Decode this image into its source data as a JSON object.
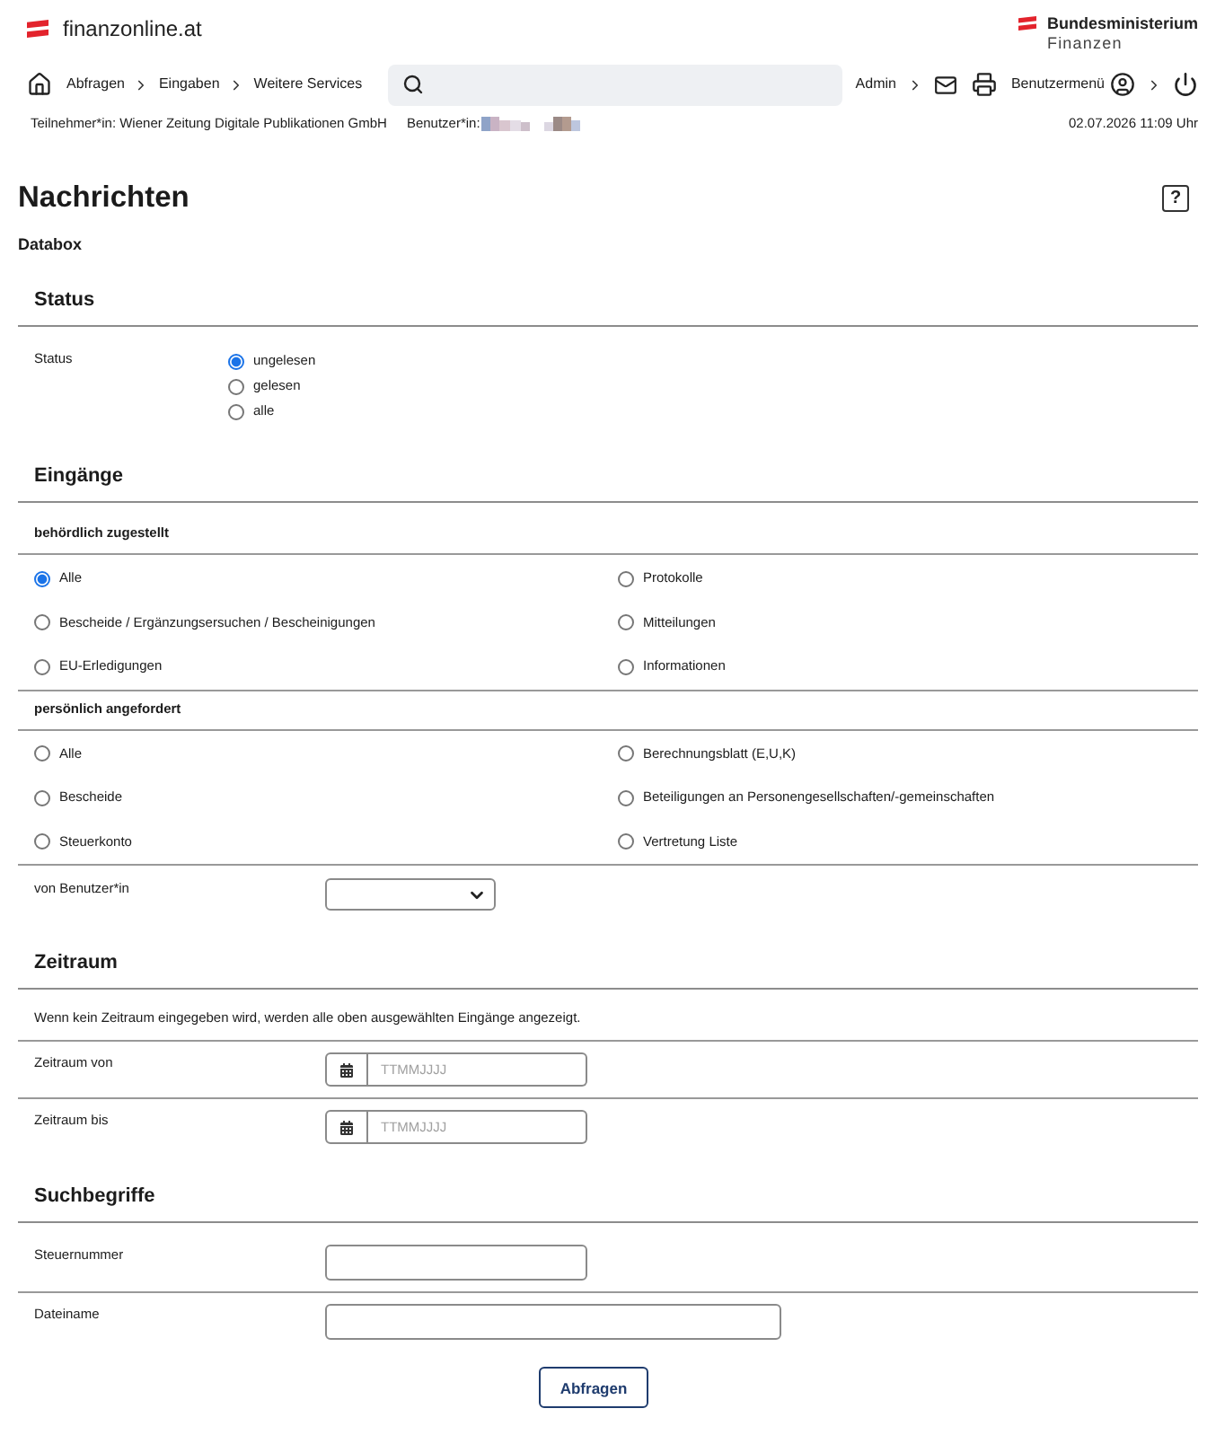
{
  "header": {
    "site_name": "finanzonline.at",
    "ministry": {
      "line_1": "Bundesministerium",
      "line_2": "Finanzen"
    }
  },
  "nav": {
    "breadcrumbs": [
      {
        "label": "Abfragen"
      },
      {
        "label": "Eingaben"
      },
      {
        "label": "Weitere Services"
      }
    ],
    "admin": "Admin",
    "user_menu": "Benutzermenü"
  },
  "info_bar": {
    "participant": "Teilnehmer*in: Wiener Zeitung Digitale Publikationen GmbH",
    "user_label": "Benutzer*in:",
    "datetime": "02.07.2026 11:09 Uhr"
  },
  "page": {
    "title": "Nachrichten",
    "help_button": "?",
    "subtitle": "Databox"
  },
  "status": {
    "heading": "Status",
    "label": "Status",
    "options": [
      {
        "label": "ungelesen",
        "selected": true
      },
      {
        "label": "gelesen",
        "selected": false
      },
      {
        "label": "alle",
        "selected": false
      }
    ]
  },
  "eingaenge": {
    "heading": "Eingänge",
    "groups": [
      {
        "title": "behördlich zugestellt",
        "options": [
          {
            "label": "Alle",
            "selected": true
          },
          {
            "label": "Protokolle",
            "selected": false
          },
          {
            "label": "Bescheide / Ergänzungsersuchen / Bescheinigungen",
            "selected": false
          },
          {
            "label": "Mitteilungen",
            "selected": false
          },
          {
            "label": "EU-Erledigungen",
            "selected": false
          },
          {
            "label": "Informationen",
            "selected": false
          }
        ]
      },
      {
        "title": "persönlich angefordert",
        "options": [
          {
            "label": "Alle",
            "selected": false
          },
          {
            "label": "Berechnungsblatt (E,U,K)",
            "selected": false
          },
          {
            "label": "Bescheide",
            "selected": false
          },
          {
            "label": "Beteiligungen an Personengesellschaften/-gemeinschaften",
            "selected": false
          },
          {
            "label": "Steuerkonto",
            "selected": false
          },
          {
            "label": "Vertretung Liste",
            "selected": false
          }
        ]
      }
    ],
    "user_filter": {
      "label": "von Benutzer*in"
    }
  },
  "zeitraum": {
    "heading": "Zeitraum",
    "note": "Wenn kein Zeitraum eingegeben wird, werden alle oben ausgewählten Eingänge angezeigt.",
    "fields": [
      {
        "label": "Zeitraum von",
        "placeholder": "TTMMJJJJ"
      },
      {
        "label": "Zeitraum bis",
        "placeholder": "TTMMJJJJ"
      }
    ]
  },
  "suchbegriffe": {
    "heading": "Suchbegriffe",
    "fields": [
      {
        "label": "Steuernummer",
        "kind": "short"
      },
      {
        "label": "Dateiname",
        "kind": "long"
      }
    ]
  },
  "submit_button": "Abfragen"
}
